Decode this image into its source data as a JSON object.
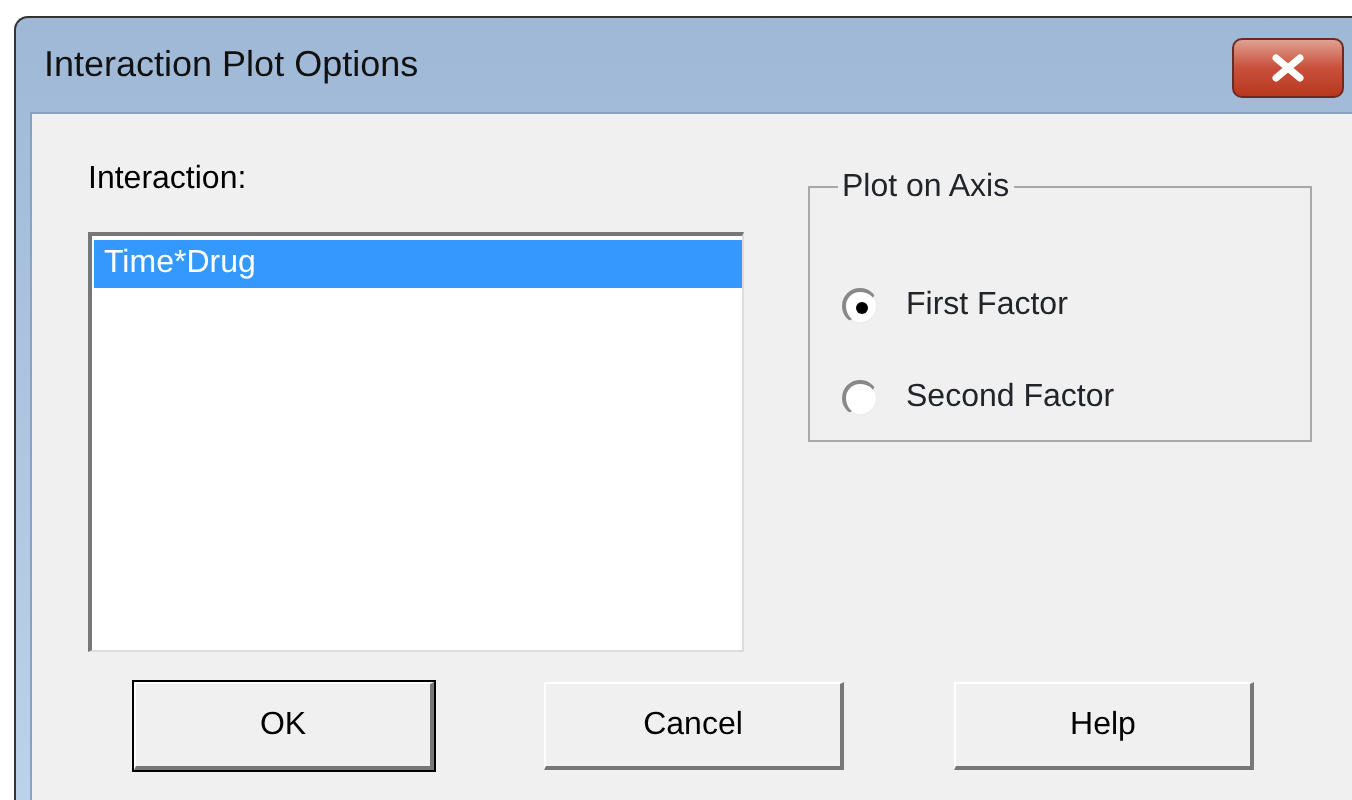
{
  "window": {
    "title": "Interaction Plot Options"
  },
  "interaction": {
    "label": "Interaction:",
    "items": [
      {
        "label": "Time*Drug",
        "selected": true
      }
    ]
  },
  "plot_on_axis": {
    "legend": "Plot on Axis",
    "options": [
      {
        "label": "First Factor",
        "selected": true
      },
      {
        "label": "Second Factor",
        "selected": false
      }
    ]
  },
  "buttons": [
    {
      "label": "OK",
      "default": true
    },
    {
      "label": "Cancel",
      "default": false
    },
    {
      "label": "Help",
      "default": false
    }
  ]
}
